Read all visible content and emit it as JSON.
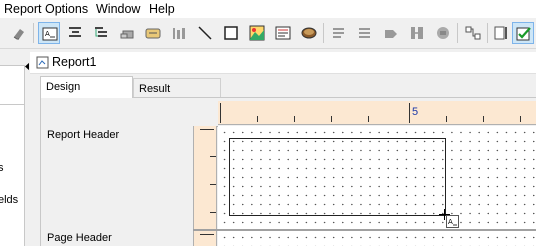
{
  "menubar": {
    "items": [
      "Report",
      "Options",
      "Window",
      "Help"
    ]
  },
  "toolbar": {
    "buttons": [
      "eraser-icon",
      "text-field-icon",
      "align-icon",
      "tree-icon",
      "stack-icon",
      "label-icon",
      "barcode-icon",
      "line-icon",
      "rectangle-icon",
      "image-icon",
      "richtext-icon",
      "chart-icon",
      "cross-tab-icon",
      "group-icon",
      "sort-icon",
      "filter-icon",
      "subreport-icon",
      "shape-icon",
      "link-icon",
      "export-icon",
      "checkbox-icon"
    ],
    "active": [
      "text-field-icon",
      "checkbox-icon"
    ]
  },
  "left_panel": {
    "items": [
      "s",
      "elds"
    ]
  },
  "document": {
    "title": "Report1",
    "tabs": [
      "Design",
      "Result"
    ],
    "active_tab": "Design"
  },
  "ruler": {
    "label": "5"
  },
  "sections": [
    "Report Header",
    "Page Header"
  ],
  "colors": {
    "ruler": "#fce8d2",
    "selected_tab": "#ffffff",
    "toolbar_active": "#cde6f7"
  }
}
